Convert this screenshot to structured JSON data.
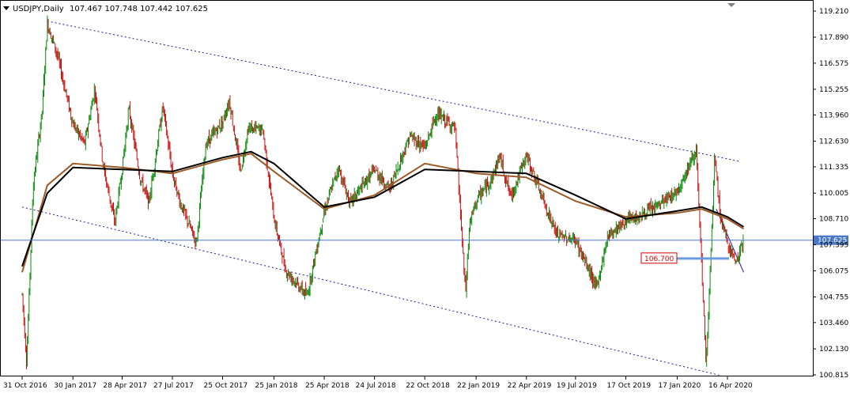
{
  "header": {
    "symbol_timeframe": "USDJPY,Daily",
    "ohlc": "107.467 107.748 107.442 107.625"
  },
  "chart_data": {
    "type": "candlestick",
    "title": "USDJPY,Daily",
    "ohlc_values": {
      "open": 107.467,
      "high": 107.748,
      "low": 107.442,
      "close": 107.625
    },
    "y_ticks": [
      "119.210",
      "117.890",
      "116.575",
      "115.255",
      "113.960",
      "112.630",
      "111.335",
      "110.005",
      "108.710",
      "107.395",
      "106.075",
      "104.755",
      "103.460",
      "102.130",
      "100.815"
    ],
    "ylim": [
      100.815,
      119.21
    ],
    "x_ticks": [
      "31 Oct 2016",
      "30 Jan 2017",
      "28 Apr 2017",
      "27 Jul 2017",
      "25 Oct 2017",
      "25 Jan 2018",
      "25 Apr 2018",
      "24 Jul 2018",
      "22 Oct 2018",
      "22 Jan 2019",
      "22 Apr 2019",
      "19 Jul 2019",
      "17 Oct 2019",
      "17 Jan 2020",
      "16 Apr 2020"
    ],
    "current_price_label": "107.625",
    "level_label": "106.700",
    "price_path": [
      [
        "31 Oct 2016",
        104.9
      ],
      [
        "2016-11-08",
        101.5
      ],
      [
        "2016-11-20",
        110.5
      ],
      [
        "2016-12-06",
        114.2
      ],
      [
        "2016-12-15",
        118.6
      ],
      [
        "2017-01-02",
        117.0
      ],
      [
        "30 Jan 2017",
        113.5
      ],
      [
        "2017-02-20",
        112.5
      ],
      [
        "2017-03-10",
        115.3
      ],
      [
        "2017-03-25",
        111.4
      ],
      [
        "2017-04-15",
        108.5
      ],
      [
        "28 Apr 2017",
        111.2
      ],
      [
        "2017-05-10",
        114.3
      ],
      [
        "2017-05-30",
        110.8
      ],
      [
        "2017-06-15",
        109.5
      ],
      [
        "2017-07-10",
        114.4
      ],
      [
        "27 Jul 2017",
        111.0
      ],
      [
        "2017-08-10",
        109.5
      ],
      [
        "2017-09-08",
        107.5
      ],
      [
        "2017-09-25",
        112.5
      ],
      [
        "25 Oct 2017",
        113.6
      ],
      [
        "2017-11-06",
        114.7
      ],
      [
        "2017-11-26",
        111.1
      ],
      [
        "2017-12-10",
        113.3
      ],
      [
        "2018-01-05",
        113.2
      ],
      [
        "25 Jan 2018",
        108.7
      ],
      [
        "2018-02-15",
        106.1
      ],
      [
        "2018-03-05",
        105.5
      ],
      [
        "2018-03-25",
        104.8
      ],
      [
        "25 Apr 2018",
        109.1
      ],
      [
        "2018-05-20",
        111.3
      ],
      [
        "2018-06-10",
        109.5
      ],
      [
        "24 Jul 2018",
        111.2
      ],
      [
        "2018-08-20",
        110.2
      ],
      [
        "2018-09-25",
        112.9
      ],
      [
        "22 Oct 2018",
        112.3
      ],
      [
        "2018-11-12",
        114.0
      ],
      [
        "2018-12-15",
        113.3
      ],
      [
        "2019-01-03",
        104.9
      ],
      [
        "2019-01-10",
        108.4
      ],
      [
        "22 Jan 2019",
        109.6
      ],
      [
        "2019-02-20",
        110.8
      ],
      [
        "2019-03-05",
        111.9
      ],
      [
        "2019-03-25",
        109.8
      ],
      [
        "22 Apr 2019",
        111.9
      ],
      [
        "2019-05-20",
        109.8
      ],
      [
        "2019-06-15",
        107.9
      ],
      [
        "19 Jul 2019",
        107.6
      ],
      [
        "2019-08-26",
        105.2
      ],
      [
        "2019-09-15",
        107.9
      ],
      [
        "17 Oct 2019",
        108.6
      ],
      [
        "2019-11-15",
        108.9
      ],
      [
        "2019-12-15",
        109.4
      ],
      [
        "17 Jan 2020",
        110.1
      ],
      [
        "2020-02-20",
        112.2
      ],
      [
        "2020-03-09",
        101.2
      ],
      [
        "2020-03-24",
        111.7
      ],
      [
        "2020-04-05",
        108.5
      ],
      [
        "16 Apr 2020",
        107.5
      ],
      [
        "2020-05-01",
        106.5
      ],
      [
        "2020-05-15",
        107.6
      ]
    ],
    "ma_slow_path": [
      [
        "31 Oct 2016",
        106.3
      ],
      [
        "2016-12-15",
        110.0
      ],
      [
        "30 Jan 2017",
        111.3
      ],
      [
        "28 Apr 2017",
        111.2
      ],
      [
        "27 Jul 2017",
        111.1
      ],
      [
        "25 Oct 2017",
        111.8
      ],
      [
        "2017-12-15",
        112.1
      ],
      [
        "25 Jan 2018",
        111.5
      ],
      [
        "25 Apr 2018",
        109.3
      ],
      [
        "24 Jul 2018",
        109.8
      ],
      [
        "22 Oct 2018",
        111.2
      ],
      [
        "22 Jan 2019",
        111.1
      ],
      [
        "22 Apr 2019",
        111.0
      ],
      [
        "19 Jul 2019",
        109.9
      ],
      [
        "17 Oct 2019",
        108.7
      ],
      [
        "17 Jan 2020",
        109.1
      ],
      [
        "2020-03-01",
        109.3
      ],
      [
        "16 Apr 2020",
        108.8
      ],
      [
        "2020-05-15",
        108.3
      ]
    ],
    "ma_fast_path": [
      [
        "31 Oct 2016",
        106.0
      ],
      [
        "2016-12-15",
        110.4
      ],
      [
        "30 Jan 2017",
        111.5
      ],
      [
        "28 Apr 2017",
        111.3
      ],
      [
        "27 Jul 2017",
        111.0
      ],
      [
        "25 Oct 2017",
        111.7
      ],
      [
        "2017-12-15",
        112.0
      ],
      [
        "25 Jan 2018",
        111.1
      ],
      [
        "25 Apr 2018",
        109.2
      ],
      [
        "24 Jul 2018",
        109.9
      ],
      [
        "22 Oct 2018",
        111.5
      ],
      [
        "22 Jan 2019",
        111.0
      ],
      [
        "22 Apr 2019",
        110.8
      ],
      [
        "19 Jul 2019",
        109.6
      ],
      [
        "17 Oct 2019",
        108.8
      ],
      [
        "17 Jan 2020",
        109.0
      ],
      [
        "2020-03-01",
        109.2
      ],
      [
        "16 Apr 2020",
        108.7
      ],
      [
        "2020-05-15",
        108.2
      ]
    ],
    "channel_upper": [
      [
        "2016-12-15",
        118.7
      ],
      [
        "2020-05-10",
        111.6
      ]
    ],
    "channel_lower": [
      [
        "31 Oct 2016",
        109.3
      ],
      [
        "2020-04-01",
        100.8
      ]
    ],
    "short_trendline": [
      [
        "2020-03-27",
        109.2
      ],
      [
        "2020-05-15",
        106.0
      ]
    ],
    "colors": {
      "up": "#0a8a0a",
      "down": "#c81010",
      "ma_slow": "#000000",
      "ma_fast": "#9c5a28",
      "channel": "#1a1aa0",
      "price_line": "#4a78c8",
      "level_line": "#6a9ae0",
      "level_tag": "#d40000",
      "price_tag_bg": "#4a78c8"
    }
  }
}
